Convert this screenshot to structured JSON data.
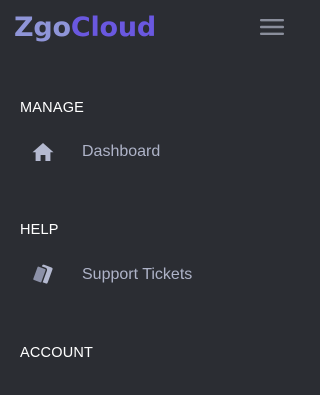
{
  "brand": {
    "part1": "Zgo",
    "part2": "Cloud"
  },
  "header": {
    "menu_icon": "hamburger-menu-icon"
  },
  "sections": [
    {
      "title": "MANAGE",
      "items": [
        {
          "label": "Dashboard",
          "icon": "home-icon"
        }
      ]
    },
    {
      "title": "HELP",
      "items": [
        {
          "label": "Support Tickets",
          "icon": "tickets-icon"
        }
      ]
    },
    {
      "title": "ACCOUNT",
      "items": []
    }
  ],
  "colors": {
    "background": "#2b2d33",
    "brand_primary": "#8f95d8",
    "brand_accent": "#6a58e0",
    "section_title": "#ffffff",
    "nav_text": "#aeb3c8",
    "icon": "#b4b9d0"
  }
}
